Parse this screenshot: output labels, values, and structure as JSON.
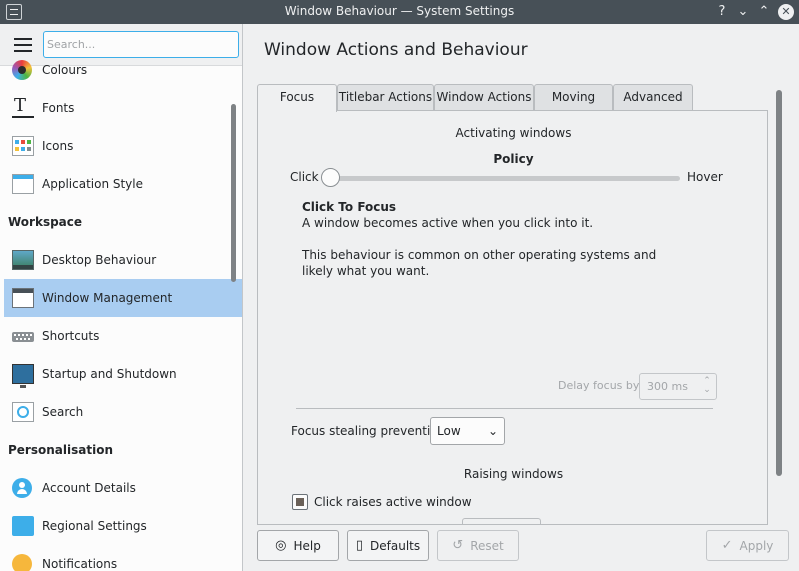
{
  "window": {
    "title": "Window Behaviour — System Settings",
    "help_glyph": "?",
    "minimize_glyph": "⌄",
    "maximize_glyph": "⌃",
    "close_glyph": "✕"
  },
  "sidebar": {
    "search_placeholder": "Search...",
    "items": [
      {
        "label": "Colours",
        "icon": "colours-icon"
      },
      {
        "label": "Fonts",
        "icon": "fonts-icon"
      },
      {
        "label": "Icons",
        "icon": "icons-icon"
      },
      {
        "label": "Application Style",
        "icon": "application-style-icon"
      },
      {
        "label": "Desktop Behaviour",
        "icon": "desktop-behaviour-icon"
      },
      {
        "label": "Window Management",
        "icon": "window-management-icon",
        "selected": true
      },
      {
        "label": "Shortcuts",
        "icon": "keyboard-icon"
      },
      {
        "label": "Startup and Shutdown",
        "icon": "monitor-icon"
      },
      {
        "label": "Search",
        "icon": "search-icon"
      },
      {
        "label": "Account Details",
        "icon": "user-icon"
      },
      {
        "label": "Regional Settings",
        "icon": "chat-bubble-icon"
      },
      {
        "label": "Notifications",
        "icon": "bell-icon"
      }
    ],
    "sections": {
      "workspace": "Workspace",
      "personalisation": "Personalisation"
    }
  },
  "main": {
    "title": "Window Actions and Behaviour",
    "tabs": [
      {
        "label": "Focus",
        "active": true
      },
      {
        "label": "Titlebar Actions"
      },
      {
        "label": "Window Actions"
      },
      {
        "label": "Moving"
      },
      {
        "label": "Advanced"
      }
    ],
    "focus": {
      "activating_header": "Activating windows",
      "policy_label": "Policy",
      "slider_min_label": "Click",
      "slider_max_label": "Hover",
      "slider_value": 0,
      "policy_name": "Click To Focus",
      "policy_desc_1": "A window becomes active when you click into it.",
      "policy_desc_2": "This behaviour is common on other operating systems and",
      "policy_desc_3": "likely what you want.",
      "delay_label": "Delay focus by",
      "delay_value": "300 ms",
      "focus_stealing_label": "Focus stealing prevention",
      "focus_stealing_value": "Low",
      "raising_header": "Raising windows",
      "click_raises_label": "Click raises active window",
      "click_raises_checked": true
    }
  },
  "buttons": {
    "help": "Help",
    "defaults": "Defaults",
    "reset": "Reset",
    "apply": "Apply"
  },
  "colors": {
    "accent": "#3daee9",
    "selection": "#a9cdf1",
    "titlebar": "#475057"
  }
}
